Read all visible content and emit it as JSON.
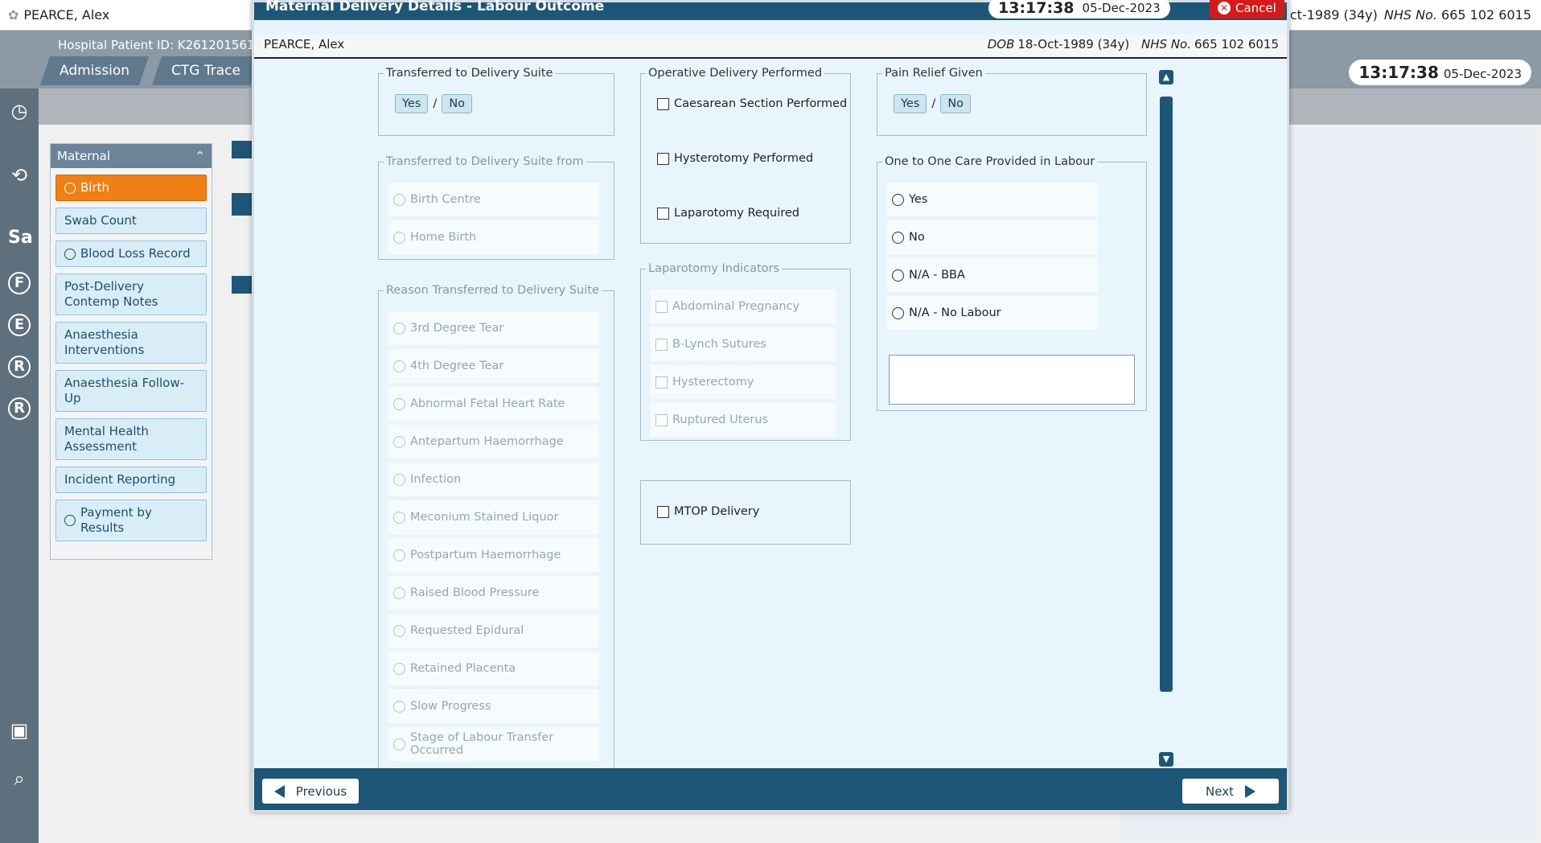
{
  "background": {
    "patient_name": "PEARCE, Alex",
    "dob_nhs": "18-Oct-1989 (34y)",
    "nhs_label": "NHS No.",
    "nhs_number": "665 102 6015",
    "hospital_id": "Hospital Patient ID: K261201561,",
    "tabs": [
      "Admission",
      "CTG Trace"
    ],
    "clock_time": "13:17:38",
    "clock_date": "05-Dec-2023",
    "rail_letters": [
      "Sa",
      "F",
      "E",
      "R",
      "R"
    ],
    "maternal": {
      "title": "Maternal",
      "items": [
        {
          "label": "Birth",
          "active": true,
          "circle": true
        },
        {
          "label": "Swab Count",
          "active": false,
          "circle": false
        },
        {
          "label": "Blood Loss Record",
          "active": false,
          "circle": true
        },
        {
          "label": "Post-Delivery Contemp Notes",
          "active": false,
          "circle": false
        },
        {
          "label": "Anaesthesia Interventions",
          "active": false,
          "circle": false
        },
        {
          "label": "Anaesthesia Follow-Up",
          "active": false,
          "circle": false
        },
        {
          "label": "Mental Health Assessment",
          "active": false,
          "circle": false
        },
        {
          "label": "Incident Reporting",
          "active": false,
          "circle": false
        },
        {
          "label": "Payment by Results",
          "active": false,
          "circle": true
        }
      ]
    }
  },
  "modal": {
    "title": "Maternal Delivery Details - Labour Outcome",
    "clock_time": "13:17:38",
    "clock_date": "05-Dec-2023",
    "cancel_label": "Cancel",
    "patient_name": "PEARCE, Alex",
    "dob_label": "DOB",
    "dob": "18-Oct-1989 (34y)",
    "nhs_label": "NHS No.",
    "nhs_number": "665 102 6015",
    "transferred": {
      "legend": "Transferred to Delivery Suite",
      "yes": "Yes",
      "sep": "/",
      "no": "No"
    },
    "transferred_from": {
      "legend": "Transferred to Delivery Suite from",
      "options": [
        "Birth Centre",
        "Home Birth"
      ]
    },
    "reason": {
      "legend": "Reason Transferred to Delivery Suite",
      "options": [
        "3rd Degree Tear",
        "4th Degree Tear",
        "Abnormal Fetal Heart Rate",
        "Antepartum Haemorrhage",
        "Infection",
        "Meconium Stained Liquor",
        "Postpartum Haemorrhage",
        "Raised Blood Pressure",
        "Requested Epidural",
        "Retained Placenta",
        "Slow Progress",
        "Stage of Labour Transfer Occurred"
      ]
    },
    "operative": {
      "legend": "Operative Delivery Performed",
      "options": [
        "Caesarean Section Performed",
        "Hysterotomy Performed",
        "Laparotomy Required"
      ]
    },
    "laparotomy": {
      "legend": "Laparotomy Indicators",
      "options": [
        "Abdominal Pregnancy",
        "B-Lynch Sutures",
        "Hysterectomy",
        "Ruptured Uterus"
      ]
    },
    "mtop_label": "MTOP Delivery",
    "pain_relief": {
      "legend": "Pain Relief Given",
      "yes": "Yes",
      "sep": "/",
      "no": "No"
    },
    "one_to_one": {
      "legend": "One to One Care Provided in Labour",
      "options": [
        "Yes",
        "No",
        "N/A - BBA",
        "N/A - No Labour"
      ]
    },
    "previous_label": "Previous",
    "next_label": "Next"
  },
  "colors": {
    "primary": "#1e5677",
    "accent_active": "#f07f16",
    "cancel": "#d41a1a"
  }
}
